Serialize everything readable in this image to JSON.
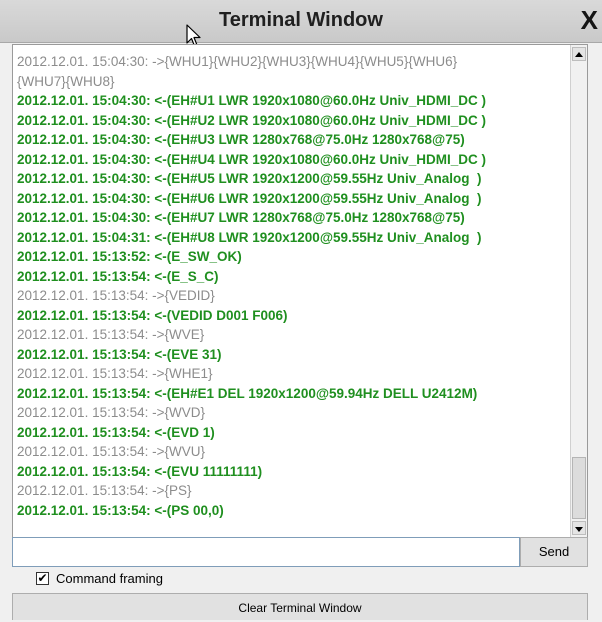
{
  "window": {
    "title": "Terminal Window",
    "close_label": "X"
  },
  "log": {
    "lines": [
      {
        "kind": "out",
        "text": "2012.12.01. 15:04:30: ->{WHU1}{WHU2}{WHU3}{WHU4}{WHU5}{WHU6}\n{WHU7}{WHU8}"
      },
      {
        "kind": "in",
        "text": "2012.12.01. 15:04:30: <-(EH#U1 LWR 1920x1080@60.0Hz Univ_HDMI_DC )"
      },
      {
        "kind": "in",
        "text": "2012.12.01. 15:04:30: <-(EH#U2 LWR 1920x1080@60.0Hz Univ_HDMI_DC )"
      },
      {
        "kind": "in",
        "text": "2012.12.01. 15:04:30: <-(EH#U3 LWR 1280x768@75.0Hz 1280x768@75)"
      },
      {
        "kind": "in",
        "text": "2012.12.01. 15:04:30: <-(EH#U4 LWR 1920x1080@60.0Hz Univ_HDMI_DC )"
      },
      {
        "kind": "in",
        "text": "2012.12.01. 15:04:30: <-(EH#U5 LWR 1920x1200@59.55Hz Univ_Analog  )"
      },
      {
        "kind": "in",
        "text": "2012.12.01. 15:04:30: <-(EH#U6 LWR 1920x1200@59.55Hz Univ_Analog  )"
      },
      {
        "kind": "in",
        "text": "2012.12.01. 15:04:30: <-(EH#U7 LWR 1280x768@75.0Hz 1280x768@75)"
      },
      {
        "kind": "in",
        "text": "2012.12.01. 15:04:31: <-(EH#U8 LWR 1920x1200@59.55Hz Univ_Analog  )"
      },
      {
        "kind": "in",
        "text": "2012.12.01. 15:13:52: <-(E_SW_OK)"
      },
      {
        "kind": "in",
        "text": "2012.12.01. 15:13:54: <-(E_S_C)"
      },
      {
        "kind": "out",
        "text": "2012.12.01. 15:13:54: ->{VEDID}"
      },
      {
        "kind": "in",
        "text": "2012.12.01. 15:13:54: <-(VEDID D001 F006)"
      },
      {
        "kind": "out",
        "text": "2012.12.01. 15:13:54: ->{WVE}"
      },
      {
        "kind": "in",
        "text": "2012.12.01. 15:13:54: <-(EVE 31)"
      },
      {
        "kind": "out",
        "text": "2012.12.01. 15:13:54: ->{WHE1}"
      },
      {
        "kind": "in",
        "text": "2012.12.01. 15:13:54: <-(EH#E1 DEL 1920x1200@59.94Hz DELL U2412M)"
      },
      {
        "kind": "out",
        "text": "2012.12.01. 15:13:54: ->{WVD}"
      },
      {
        "kind": "in",
        "text": "2012.12.01. 15:13:54: <-(EVD 1)"
      },
      {
        "kind": "out",
        "text": "2012.12.01. 15:13:54: ->{WVU}"
      },
      {
        "kind": "in",
        "text": "2012.12.01. 15:13:54: <-(EVU 11111111)"
      },
      {
        "kind": "out",
        "text": "2012.12.01. 15:13:54: ->{PS}"
      },
      {
        "kind": "in",
        "text": "2012.12.01. 15:13:54: <-(PS 00,0)"
      }
    ]
  },
  "command": {
    "value": "",
    "send_label": "Send"
  },
  "options": {
    "command_framing_label": "Command framing",
    "command_framing_checked": true
  },
  "actions": {
    "clear_label": "Clear Terminal Window"
  },
  "colors": {
    "incoming": "#1f8f1f",
    "outgoing": "#8c8c8c"
  },
  "icons": {
    "cursor": "mouse-cursor-icon",
    "check": "checkmark-icon"
  }
}
